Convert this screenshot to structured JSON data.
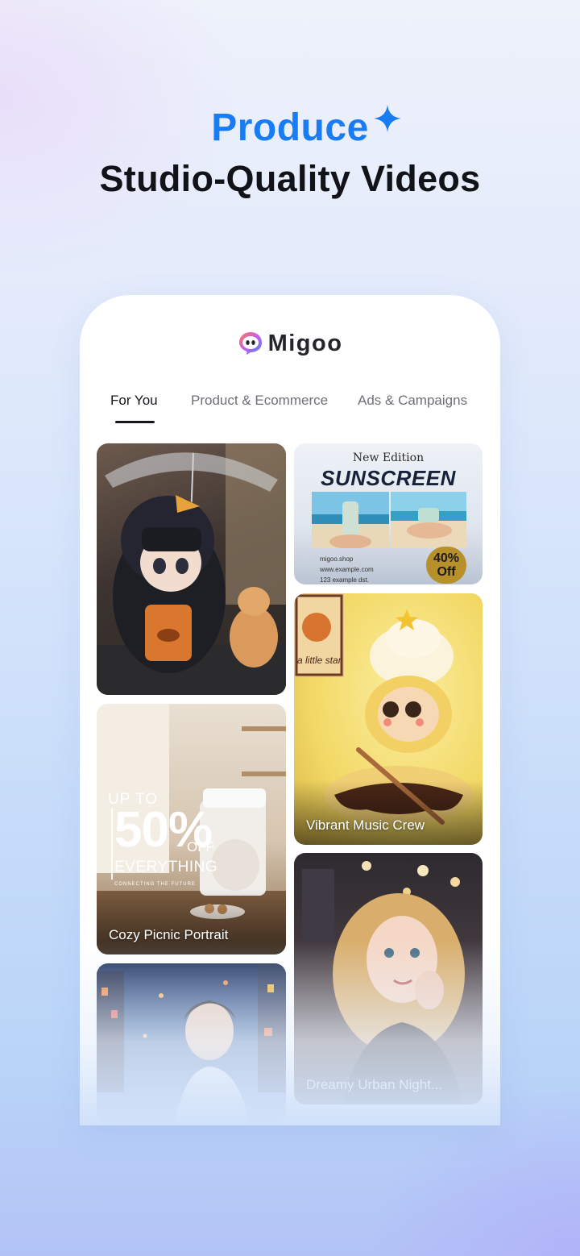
{
  "hero": {
    "line1": "Produce",
    "line2": "Studio-Quality Videos",
    "accent_color": "#1a7cf2",
    "sparkle_icon": "sparkle-icon"
  },
  "app": {
    "brand": "Migoo",
    "logo_icon": "migoo-chat-bubble-logo-icon"
  },
  "tabs": [
    {
      "label": "For You",
      "active": true
    },
    {
      "label": "Product & Ecommerce",
      "active": false
    },
    {
      "label": "Ads & Campaigns",
      "active": false
    }
  ],
  "cards": {
    "penguin_girl": {
      "label": ""
    },
    "sunscreen": {
      "label": "",
      "edition": "New Edition",
      "title": "SUNSCREEN",
      "lines": [
        "migoo.shop",
        "www.example.com",
        "123 example dst."
      ],
      "badge_line1": "40%",
      "badge_line2": "Off"
    },
    "coffee": {
      "label": "Cozy Picnic Portrait",
      "promo_top": "UP TO",
      "promo_big": "50%",
      "promo_off": "OFF",
      "promo_everything": "EVERYTHING",
      "promo_small": "CONNECTING THE FUTURE"
    },
    "cupcake": {
      "label": "Vibrant Music Crew",
      "poster_text": "a little star"
    },
    "city_man": {
      "label": ""
    },
    "blonde_girl": {
      "label": "Dreamy Urban Night..."
    }
  }
}
